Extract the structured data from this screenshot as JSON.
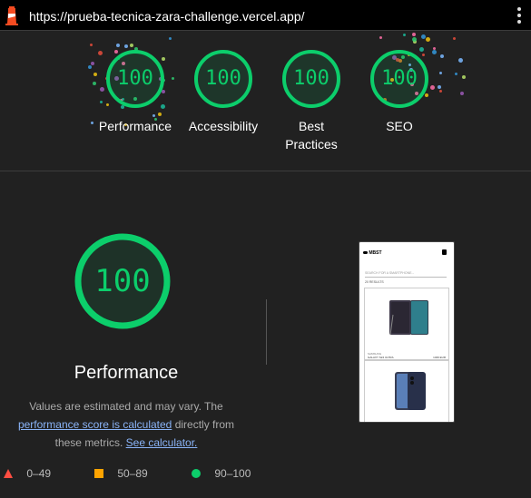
{
  "topbar": {
    "url": "https://prueba-tecnica-zara-challenge.vercel.app/"
  },
  "categories": [
    {
      "score": "100",
      "label_line1": "Performance",
      "label_line2": ""
    },
    {
      "score": "100",
      "label_line1": "Accessibility",
      "label_line2": ""
    },
    {
      "score": "100",
      "label_line1": "Best",
      "label_line2": "Practices"
    },
    {
      "score": "100",
      "label_line1": "SEO",
      "label_line2": ""
    }
  ],
  "performance": {
    "score": "100",
    "title": "Performance",
    "desc_part1": "Values are estimated and may vary. The ",
    "desc_link1": "performance score is calculated",
    "desc_part2": " directly from these metrics. ",
    "desc_link2": "See calculator."
  },
  "legend": {
    "fail": "0–49",
    "average": "50–89",
    "pass": "90–100"
  },
  "thumbnail": {
    "brand": "MBST",
    "search_placeholder": "SEARCH FOR A SMARTPHONE...",
    "results": "20 RESULTS",
    "card1_brand": "SAMSUNG",
    "card1_model": "GALAXY S24 ULTRA",
    "card1_price": "1329 EUR"
  },
  "colors": {
    "pass": "#0cce6b",
    "average": "#ffa400",
    "fail": "#ff4e42",
    "link": "#8ab4f8"
  }
}
